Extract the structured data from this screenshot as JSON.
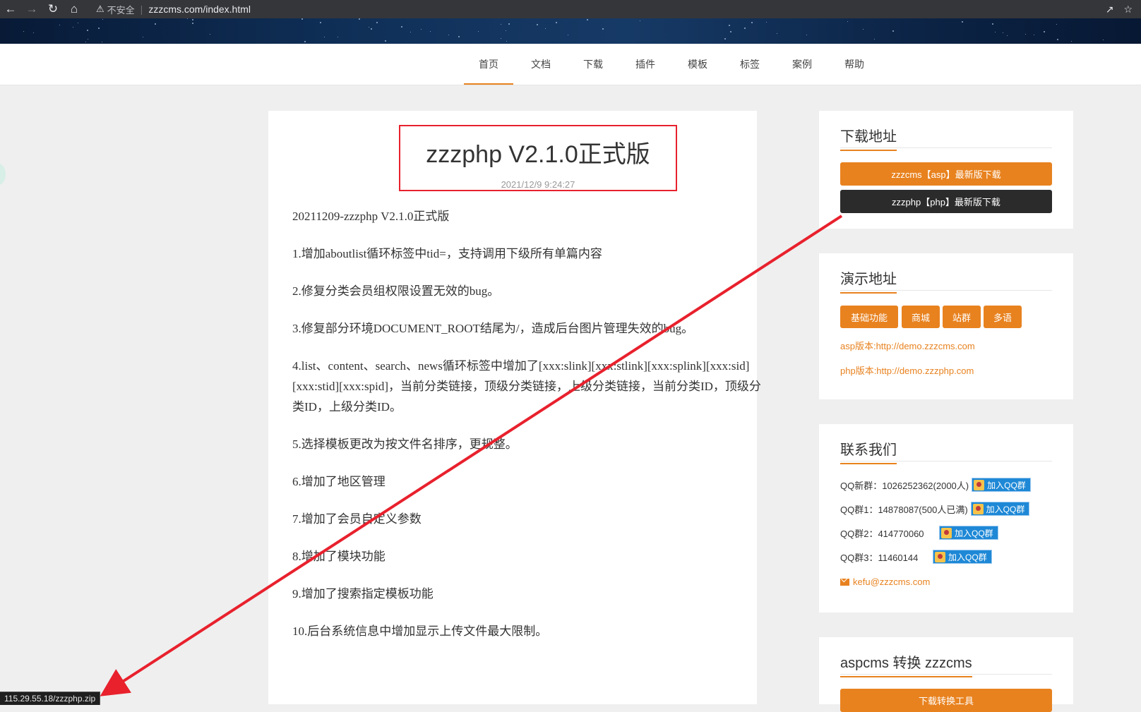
{
  "browser": {
    "url_prefix": "不安全",
    "url": "zzzcms.com/index.html"
  },
  "nav": {
    "items": [
      "首页",
      "文档",
      "下载",
      "插件",
      "模板",
      "标签",
      "案例",
      "帮助"
    ],
    "active_index": 0
  },
  "article": {
    "title": "zzzphp V2.1.0正式版",
    "date": "2021/12/9 9:24:27",
    "paragraphs": [
      "20211209-zzzphp V2.1.0正式版",
      "1.增加aboutlist循环标签中tid=，支持调用下级所有单篇内容",
      "2.修复分类会员组权限设置无效的bug。",
      "3.修复部分环境DOCUMENT_ROOT结尾为/，造成后台图片管理失效的bug。",
      "4.list、content、search、news循环标签中增加了[xxx:slink][xxx:stlink][xxx:splink][xxx:sid][xxx:stid][xxx:spid]，当前分类链接，顶级分类链接，上级分类链接，当前分类ID，顶级分类ID，上级分类ID。",
      "5.选择模板更改为按文件名排序，更规整。",
      "6.增加了地区管理",
      "7.增加了会员自定义参数",
      "8.增加了模块功能",
      "9.增加了搜索指定模板功能",
      "10.后台系统信息中增加显示上传文件最大限制。"
    ]
  },
  "sidebar": {
    "download": {
      "title": "下载地址",
      "asp_button": "zzzcms【asp】最新版下载",
      "php_button": "zzzphp【php】最新版下载"
    },
    "demo": {
      "title": "演示地址",
      "tags": [
        "基础功能",
        "商城",
        "站群",
        "多语"
      ],
      "asp_link": "asp版本:http://demo.zzzcms.com",
      "php_link": "php版本:http://demo.zzzphp.com"
    },
    "contact": {
      "title": "联系我们",
      "groups": [
        {
          "label": "QQ新群：1026252362(2000人)",
          "button": "加入QQ群"
        },
        {
          "label": "QQ群1：14878087(500人已满)",
          "button": "加入QQ群"
        },
        {
          "label": "QQ群2：414770060",
          "button": "加入QQ群"
        },
        {
          "label": "QQ群3：11460144",
          "button": "加入QQ群"
        }
      ],
      "email": "kefu@zzzcms.com"
    },
    "convert": {
      "title": "aspcms 转换 zzzcms",
      "button": "下载转换工具"
    }
  },
  "status_bar": {
    "link": "115.29.55.18/zzzphp.zip"
  },
  "colors": {
    "accent": "#e8821f",
    "annotation": "#e8212d",
    "dark_button": "#2b2b2b"
  }
}
